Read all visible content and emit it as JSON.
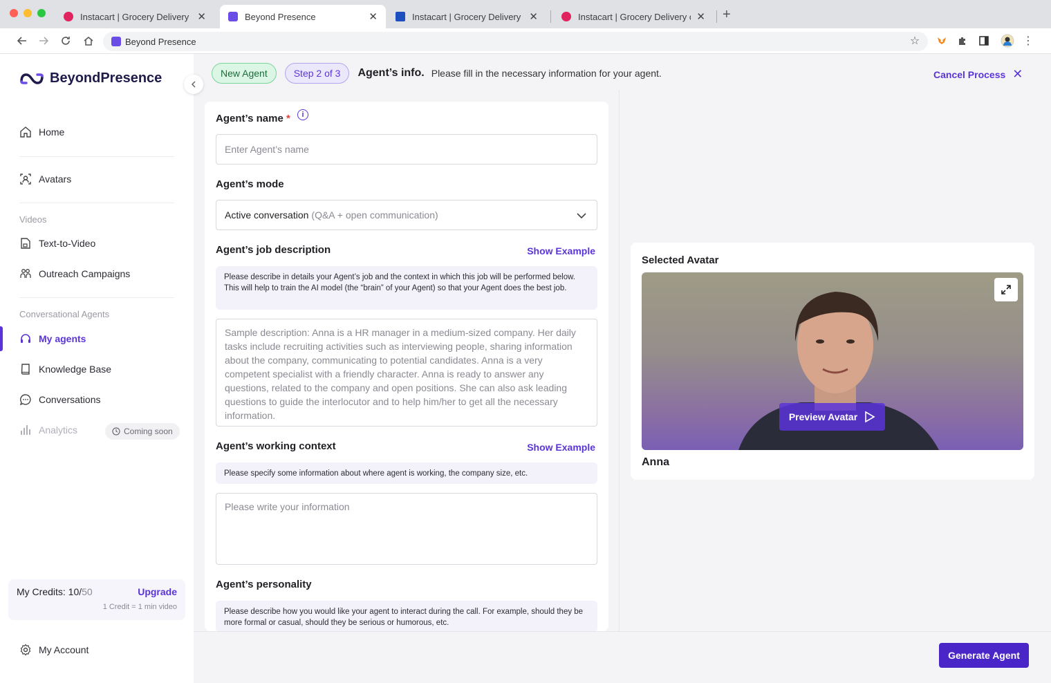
{
  "browser": {
    "tabs": [
      {
        "title": "Instacart | Grocery Delivery or",
        "favicon_color": "#e0245e"
      },
      {
        "title": "Beyond Presence",
        "favicon_color": "#6b4ce6"
      },
      {
        "title": "Instacart | Grocery Delivery or",
        "favicon_color": "#1d4fbf"
      },
      {
        "title": "Instacart | Grocery Delivery or",
        "favicon_color": "#e0245e"
      }
    ],
    "address": "Beyond Presence"
  },
  "sidebar": {
    "logo": "BeyondPresence",
    "items": {
      "home": "Home",
      "avatars": "Avatars",
      "text_to_video": "Text-to-Video",
      "outreach": "Outreach Campaigns",
      "my_agents": "My agents",
      "knowledge_base": "Knowledge Base",
      "conversations": "Conversations",
      "analytics": "Analytics",
      "account": "My Account"
    },
    "sections": {
      "videos": "Videos",
      "agents": "Conversational Agents"
    },
    "coming_soon": "Coming soon",
    "credits": {
      "label": "My Credits: 10/",
      "total": "50",
      "upgrade": "Upgrade",
      "hint": "1 Credit = 1 min video"
    }
  },
  "header": {
    "badge_new": "New Agent",
    "badge_step": "Step 2 of 3",
    "title": "Agent’s info.",
    "description": "Please fill in the necessary information for your agent.",
    "cancel": "Cancel Process"
  },
  "form": {
    "name_label": "Agent’s name",
    "name_required": "*",
    "name_placeholder": "Enter Agent’s name",
    "mode_label": "Agent’s mode",
    "mode_value": "Active conversation",
    "mode_sub": "(Q&A + open communication)",
    "job_label": "Agent’s job description",
    "show_example": "Show Example",
    "job_hint": "Please describe in details your Agent’s job and the context in which this job will be performed below. This will help to train the AI model (the “brain” of your Agent) so that your Agent does the best job.",
    "job_placeholder": "Sample description: Anna is a HR manager in a medium-sized company. Her daily tasks include recruiting activities such as interviewing people, sharing information about the company, communicating to potential candidates. Anna is a very competent specialist with a friendly character. Anna is ready to answer any questions, related to the company and open positions. She can also ask leading questions to guide the interlocutor and to help him/her to get all the necessary information.",
    "context_label": "Agent’s working context",
    "context_hint": "Please specify some information about where agent is working, the company size, etc.",
    "context_placeholder": "Please write your information",
    "personality_label": "Agent’s personality",
    "personality_hint": "Please describe how you would like your agent to interact during the call. For example, should they be more formal or casual, should they be serious or humorous, etc."
  },
  "avatar": {
    "title": "Selected Avatar",
    "preview": "Preview Avatar",
    "name": "Anna"
  },
  "footer": {
    "generate": "Generate Agent"
  },
  "colors": {
    "accent": "#5b34d9",
    "button": "#4a26c9"
  }
}
